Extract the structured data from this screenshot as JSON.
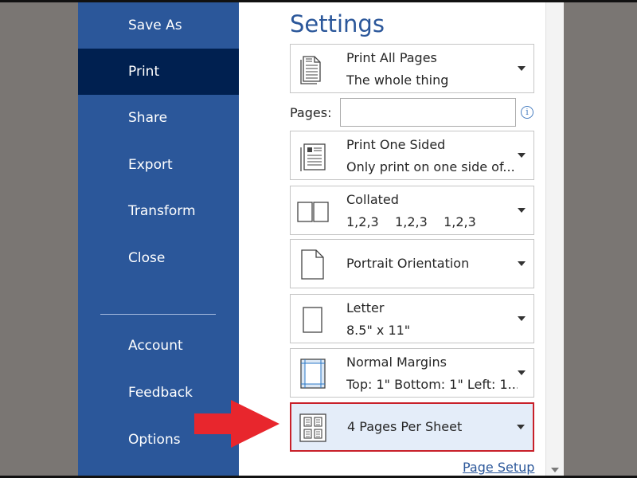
{
  "sidebar": {
    "items": [
      {
        "label": "Save As"
      },
      {
        "label": "Print"
      },
      {
        "label": "Share"
      },
      {
        "label": "Export"
      },
      {
        "label": "Transform"
      },
      {
        "label": "Close"
      },
      {
        "label": "Account"
      },
      {
        "label": "Feedback"
      },
      {
        "label": "Options"
      }
    ],
    "active": "Print",
    "colors": {
      "background": "#2b579a",
      "active": "#002050"
    }
  },
  "settings": {
    "heading": "Settings",
    "print_range": {
      "title": "Print All Pages",
      "subtitle": "The whole thing",
      "icon": "document-pages-icon"
    },
    "pages": {
      "label": "Pages:",
      "value": "",
      "placeholder": "",
      "info_icon": "info-icon"
    },
    "sides": {
      "title": "Print One Sided",
      "subtitle": "Only print on one side of...",
      "icon": "one-sided-print-icon"
    },
    "collation": {
      "title": "Collated",
      "subtitle": "1,2,3    1,2,3    1,2,3",
      "icon": "collated-pages-icon"
    },
    "orientation": {
      "title": "Portrait Orientation",
      "icon": "portrait-page-icon"
    },
    "paper_size": {
      "title": "Letter",
      "subtitle": "8.5\" x 11\"",
      "icon": "letter-paper-icon"
    },
    "margins": {
      "title": "Normal Margins",
      "subtitle": "Top: 1\" Bottom: 1\" Left: 1...",
      "icon": "margins-icon"
    },
    "pages_per_sheet": {
      "title": "4 Pages Per Sheet",
      "icon": "four-pages-per-sheet-icon",
      "highlight": "#c8202a"
    },
    "page_setup_link": "Page Setup"
  },
  "annotation": {
    "arrow_color": "#e8262d",
    "icon": "red-arrow-icon"
  }
}
